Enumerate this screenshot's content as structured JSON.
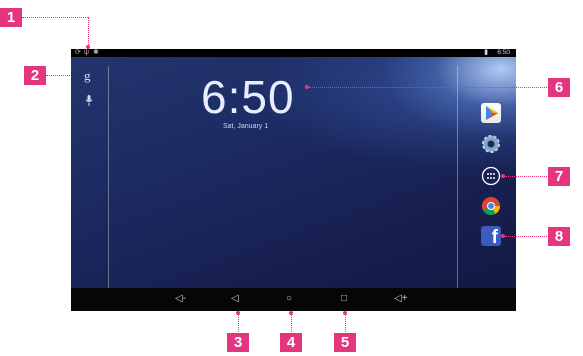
{
  "callouts": {
    "c1": "1",
    "c2": "2",
    "c3": "3",
    "c4": "4",
    "c5": "5",
    "c6": "6",
    "c7": "7",
    "c8": "8"
  },
  "status_bar": {
    "time": "6:50"
  },
  "lockscreen": {
    "clock": "6:50",
    "date": "Sat, January 1"
  },
  "left_panel": {
    "google_glyph": "g",
    "mic_glyph": "🎙"
  },
  "dock_icons": [
    "play-store-icon",
    "settings-icon",
    "app-drawer-icon",
    "chrome-icon",
    "facebook-icon"
  ],
  "facebook_letter": "f",
  "nav": {
    "vol_down": "◁-",
    "back": "◁",
    "home": "○",
    "recent": "□",
    "vol_up": "◁+"
  },
  "colors": {
    "callout": "#e3367f",
    "facebook": "#3b5bc1"
  }
}
